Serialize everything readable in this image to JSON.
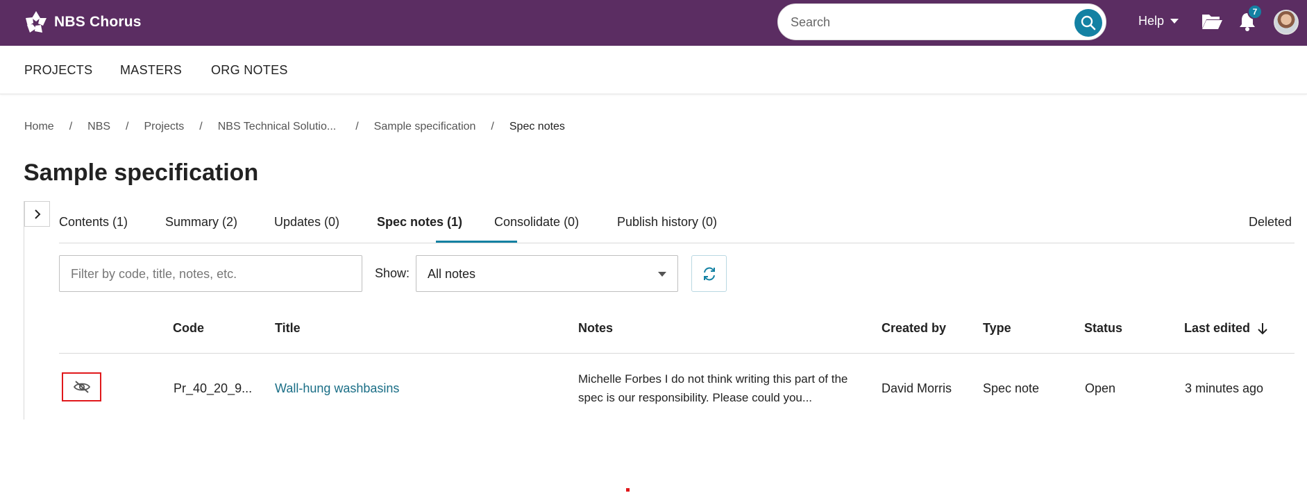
{
  "header": {
    "brand": "NBS Chorus",
    "search_placeholder": "Search",
    "help_label": "Help",
    "notification_count": "7",
    "colors": {
      "topbar": "#5b2d62",
      "accent": "#1381a3"
    }
  },
  "nav": {
    "items": [
      "PROJECTS",
      "MASTERS",
      "ORG NOTES"
    ]
  },
  "breadcrumb": [
    "Home",
    "NBS",
    "Projects",
    "NBS Technical Solutio...",
    "Sample specification",
    "Spec notes"
  ],
  "page": {
    "title": "Sample specification"
  },
  "tabs": [
    "Contents (1)",
    "Summary (2)",
    "Updates (0)",
    "Spec notes (1)",
    "Consolidate (0)",
    "Publish history (0)",
    "Deleted"
  ],
  "filters": {
    "filter_placeholder": "Filter by code, title, notes, etc.",
    "show_label": "Show:",
    "show_value": "All notes"
  },
  "table": {
    "columns": [
      "Code",
      "Title",
      "Notes",
      "Created by",
      "Type",
      "Status",
      "Last edited"
    ],
    "rows": [
      {
        "code": "Pr_40_20_9...",
        "title": "Wall-hung washbasins",
        "notes": "Michelle Forbes I do not think writing this part of the spec is our responsibility. Please could you...",
        "created_by": "David Morris",
        "type": "Spec note",
        "status": "Open",
        "last_edited": "3 minutes ago"
      }
    ]
  }
}
